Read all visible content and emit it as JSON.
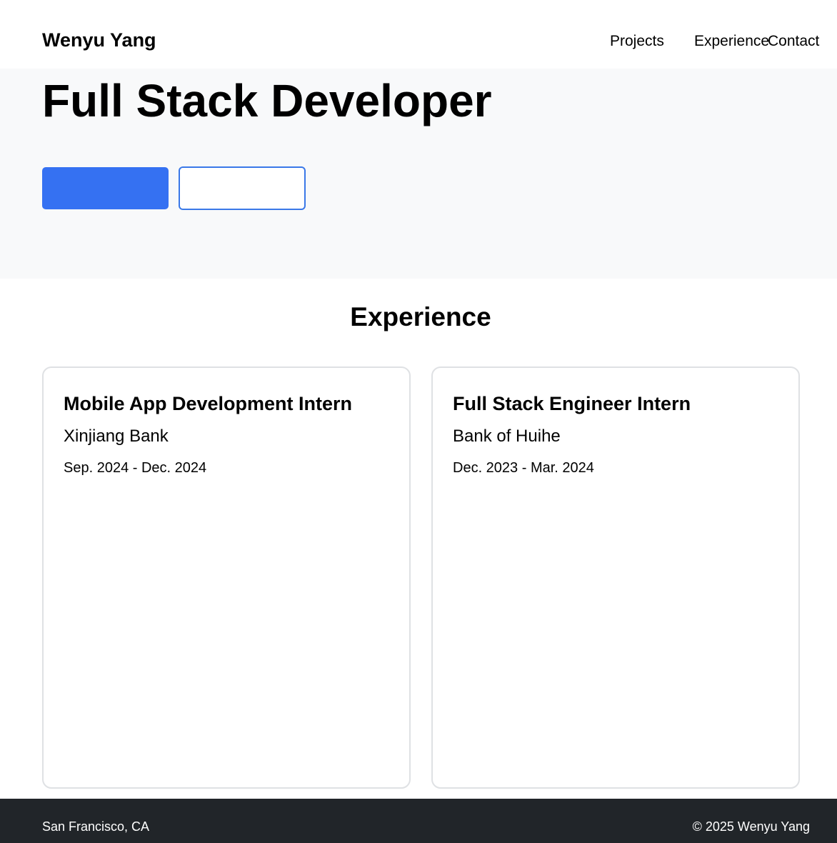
{
  "header": {
    "brand": "Wenyu Yang",
    "nav": {
      "projects": "Projects",
      "experience": "Experience",
      "contact": "Contact"
    }
  },
  "hero": {
    "title": "Full Stack Developer",
    "primary_button_label": "",
    "secondary_button_label": "",
    "colors": {
      "primary": "#3571f2",
      "background": "#f8f9fa"
    }
  },
  "experience": {
    "title": "Experience",
    "items": [
      {
        "role": "Mobile App Development Intern",
        "company": "Xinjiang Bank",
        "dates": "Sep. 2024 - Dec. 2024"
      },
      {
        "role": "Full Stack Engineer Intern",
        "company": "Bank of Huihe",
        "dates": "Dec. 2023 - Mar. 2024"
      }
    ]
  },
  "footer": {
    "location": "San Francisco, CA",
    "copyright": "© 2025 Wenyu Yang",
    "background": "#212529"
  }
}
